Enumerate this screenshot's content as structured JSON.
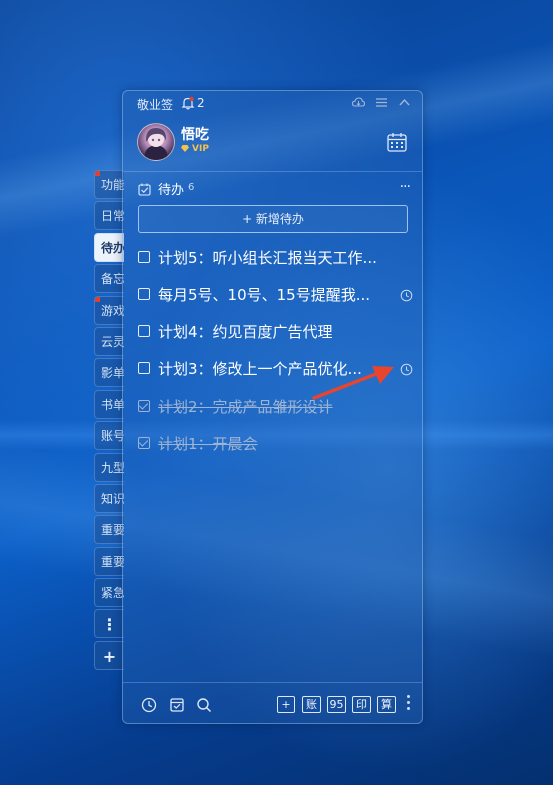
{
  "app": {
    "name": "敬业签",
    "notification_count": "2"
  },
  "user": {
    "name": "悟吃",
    "badge": "VIP"
  },
  "sidebar": {
    "tabs": [
      {
        "label": "功能",
        "marked": true
      },
      {
        "label": "日常",
        "marked": false
      },
      {
        "label": "待办",
        "marked": false,
        "active": true
      },
      {
        "label": "备忘",
        "marked": false
      },
      {
        "label": "游戏",
        "marked": true
      },
      {
        "label": "云灵",
        "marked": false
      },
      {
        "label": "影单",
        "marked": false
      },
      {
        "label": "书单",
        "marked": false
      },
      {
        "label": "账号",
        "marked": false
      },
      {
        "label": "九型",
        "marked": false
      },
      {
        "label": "知识",
        "marked": false
      },
      {
        "label": "重要",
        "marked": false
      },
      {
        "label": "重要",
        "marked": false
      },
      {
        "label": "紧急",
        "marked": false
      }
    ],
    "more_label": "⋮",
    "add_label": "+"
  },
  "todo_section": {
    "title": "待办",
    "count": "6",
    "more_label": "···",
    "add_button_label": "+ 新增待办",
    "items": [
      {
        "text": "计划5：听小组长汇报当天工作...",
        "done": false,
        "has_reminder": false
      },
      {
        "text": "每月5号、10号、15号提醒我...",
        "done": false,
        "has_reminder": true
      },
      {
        "text": "计划4：约见百度广告代理",
        "done": false,
        "has_reminder": false
      },
      {
        "text": "计划3：修改上一个产品优化...",
        "done": false,
        "has_reminder": true
      },
      {
        "text": "计划2：完成产品雏形设计",
        "done": true,
        "has_reminder": false
      },
      {
        "text": "计划1：开晨会",
        "done": true,
        "has_reminder": false
      }
    ]
  },
  "bottom_bar": {
    "icons": [
      "clock-icon",
      "archive-icon",
      "search-icon"
    ],
    "buttons": [
      "+",
      "账",
      "95",
      "印",
      "算"
    ]
  },
  "colors": {
    "accent_red": "#e2412f",
    "vip_gold": "#f2c14e",
    "panel_border": "#a0c8f5"
  }
}
